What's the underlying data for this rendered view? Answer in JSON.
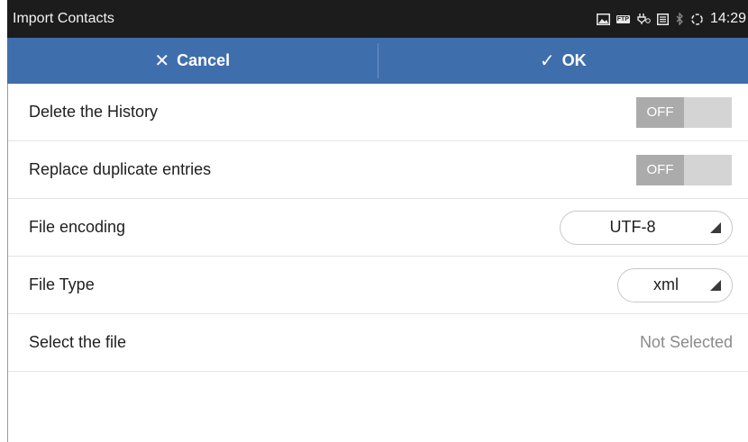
{
  "statusbar": {
    "title": "Import Contacts",
    "time": "14:29",
    "icons": [
      "image-icon",
      "ftp-icon",
      "usb-icon",
      "storage-icon",
      "bluetooth-icon",
      "sync-icon"
    ]
  },
  "actionbar": {
    "cancel_label": "Cancel",
    "cancel_icon": "✕",
    "ok_label": "OK",
    "ok_icon": "✓"
  },
  "settings": {
    "delete_history": {
      "label": "Delete the History",
      "state": "OFF"
    },
    "replace_duplicates": {
      "label": "Replace duplicate entries",
      "state": "OFF"
    },
    "file_encoding": {
      "label": "File encoding",
      "value": "UTF-8"
    },
    "file_type": {
      "label": "File Type",
      "value": "xml"
    },
    "select_file": {
      "label": "Select the file",
      "value": "Not Selected"
    }
  },
  "colors": {
    "actionbar": "#3f6ead",
    "statusbar": "#1c1c1c",
    "toggle_off_knob": "#ababab",
    "toggle_track": "#d4d4d4"
  }
}
